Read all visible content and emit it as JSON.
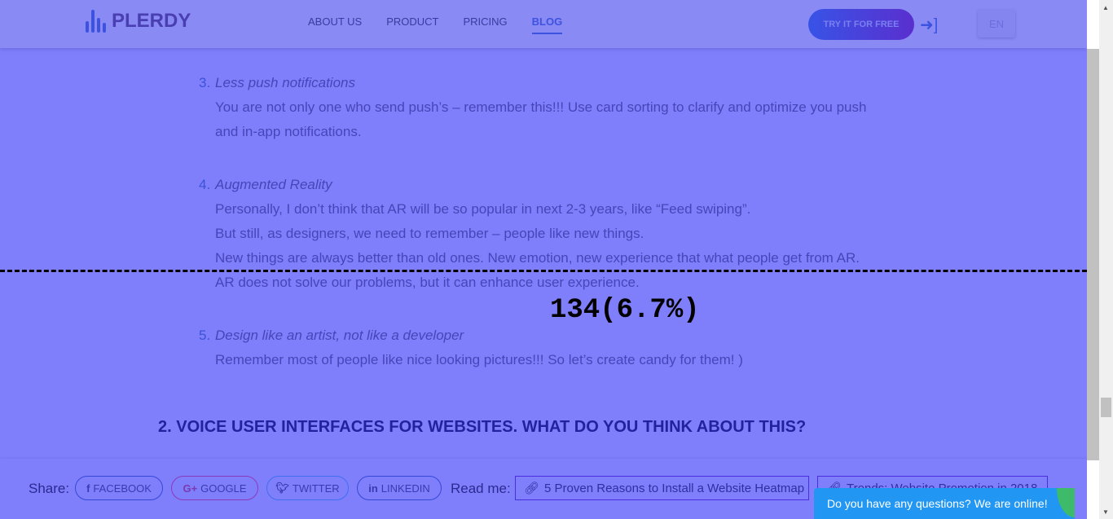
{
  "header": {
    "logo": "PLERDY",
    "nav": [
      "ABOUT US",
      "PRODUCT",
      "PRICING",
      "BLOG"
    ],
    "active_nav": "BLOG",
    "cta": "TRY IT FOR FREE",
    "lang": "EN",
    "login_icon": "sign-in-icon"
  },
  "article": {
    "items": [
      {
        "num": "3.",
        "title": "Less push notifications",
        "lines": [
          "You are not only one who send push’s – remember this!!! Use card sorting to clarify and optimize you push",
          "and in-app notifications."
        ]
      },
      {
        "num": "4.",
        "title": "Augmented Reality",
        "lines": [
          "Personally, I don’t think that AR will be so popular in next 2-3 years, like “Feed swiping”.",
          "But still, as designers, we need to remember  – people like new things.",
          "New things are always better than old ones. New emotion, new experience that what people get from AR.",
          "AR does not solve our problems, but it can enhance user experience."
        ]
      },
      {
        "num": "5.",
        "title": "Design like an artist, not like a developer",
        "lines": [
          "Remember most of people like nice looking pictures!!! So let’s create candy for them! )"
        ]
      }
    ],
    "heading": "2. VOICE USER INTERFACES FOR WEBSITES. WHAT DO YOU THINK ABOUT THIS?"
  },
  "overlay": {
    "scroll_count": "134(6.7%)"
  },
  "share": {
    "label": "Share:",
    "buttons": [
      "FACEBOOK",
      "GOOGLE",
      "TWITTER",
      "LINKEDIN"
    ],
    "read_label": "Read me:",
    "links": [
      "5 Proven Reasons to Install a Website Heatmap",
      "Trends: Website Promotion in 2018"
    ]
  },
  "chat": {
    "text": "Do you have any questions? We are online!"
  },
  "colors": {
    "overlay": "#7f7ffc",
    "accent": "#3d53e0",
    "chat": "#2196f3"
  }
}
